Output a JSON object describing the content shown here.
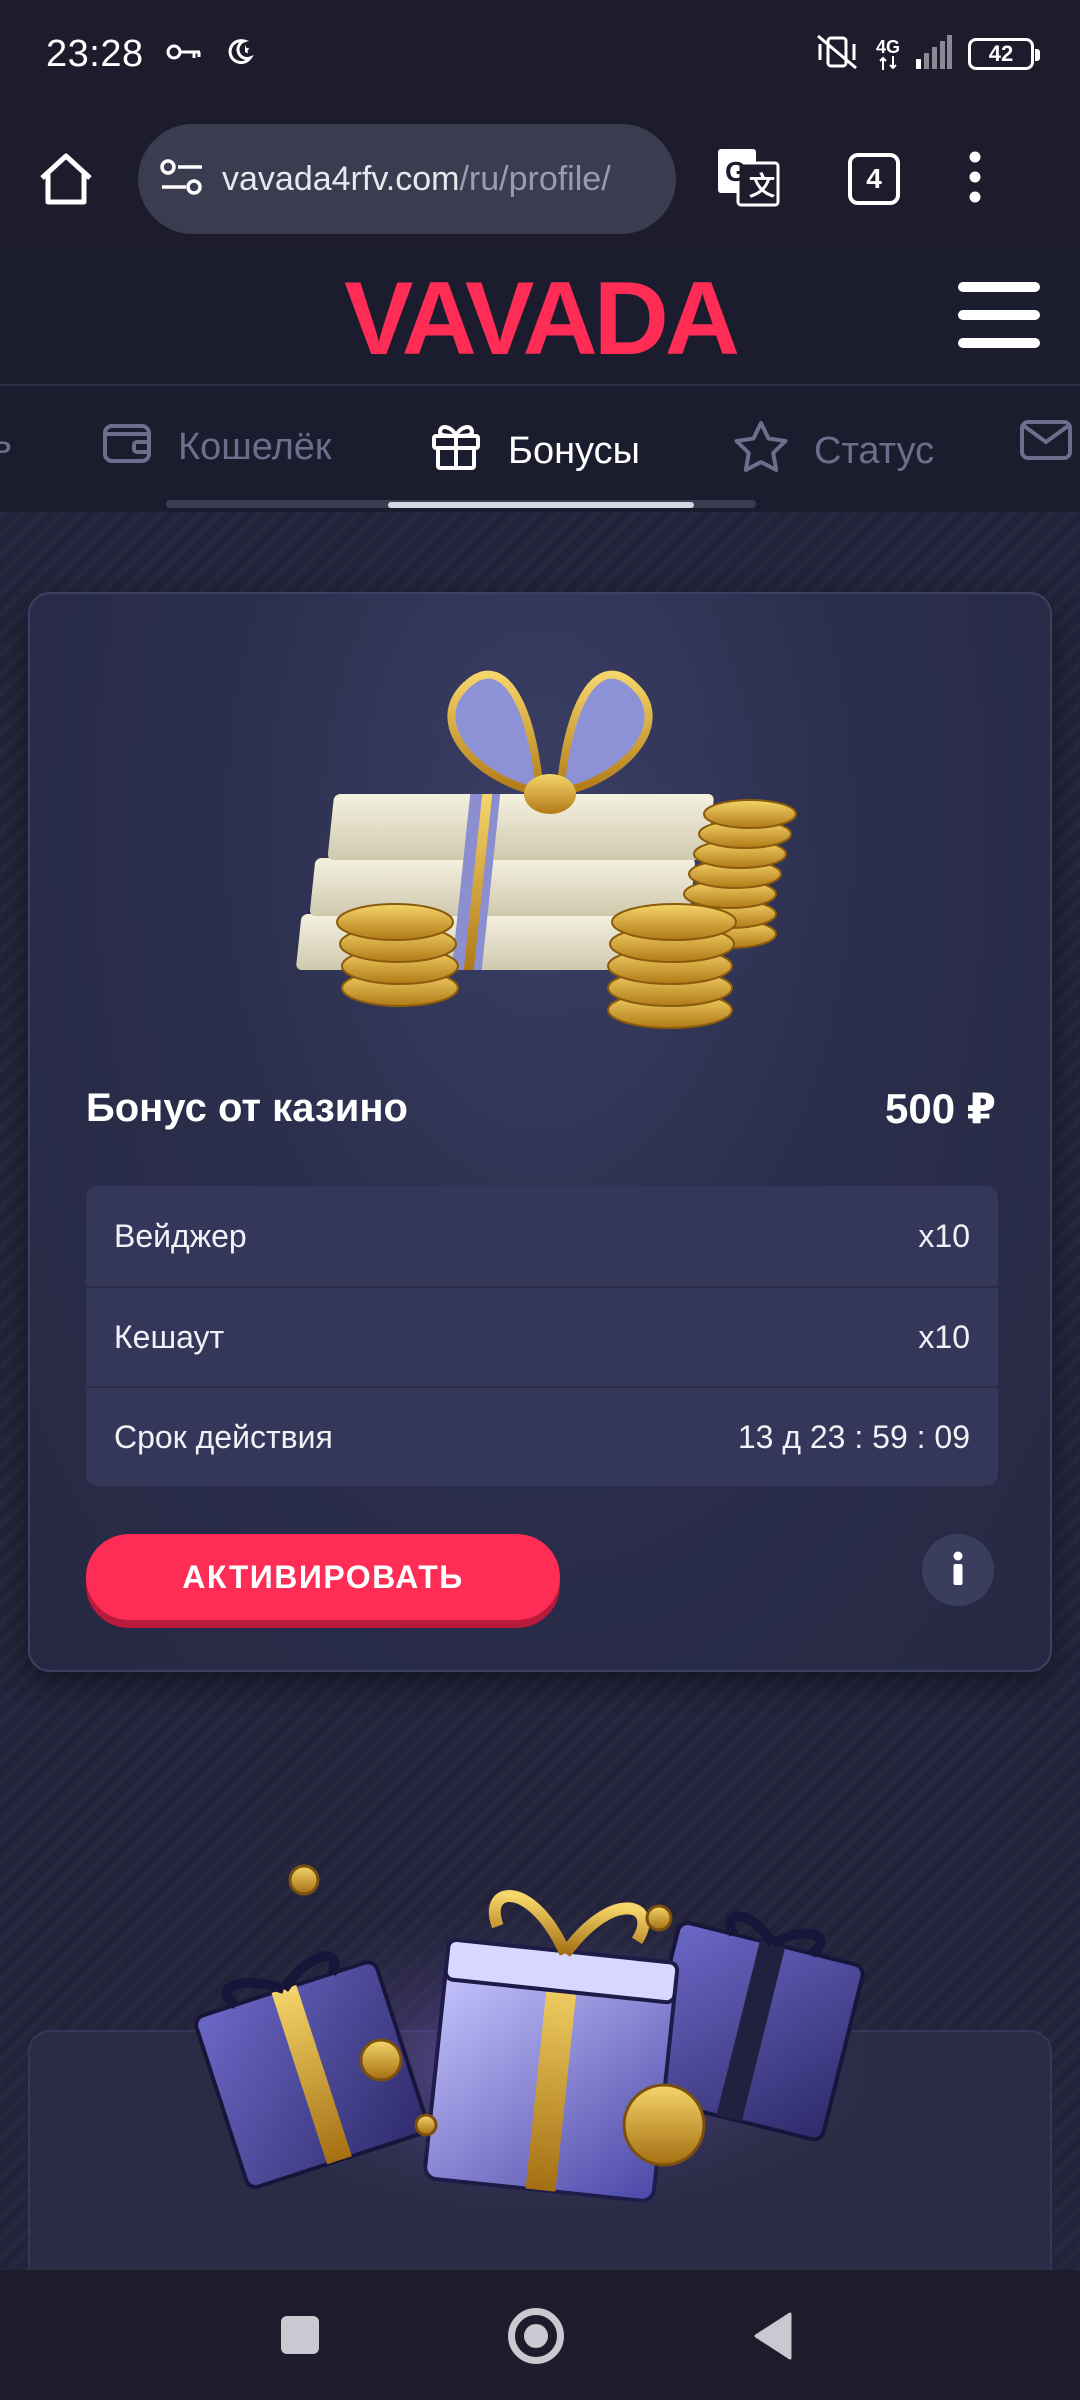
{
  "status_bar": {
    "time": "23:28",
    "network": "4G",
    "battery": "42",
    "icons": [
      "key-icon",
      "moon-icon",
      "vibrate-icon",
      "signal-icon",
      "battery-icon"
    ]
  },
  "browser": {
    "url_host": "vavada4rfv.com",
    "url_path": "/ru/profile/",
    "tab_count": "4",
    "icons": [
      "home-icon",
      "site-settings-icon",
      "translate-icon",
      "more-vert-icon"
    ]
  },
  "site": {
    "logo_text": "VAVADA",
    "brand_color": "#ff2d55"
  },
  "profile_tabs": [
    {
      "label": "ь",
      "icon": "partial-icon",
      "active": false
    },
    {
      "label": "Кошелёк",
      "icon": "wallet-icon",
      "active": false
    },
    {
      "label": "Бонусы",
      "icon": "gift-icon",
      "active": true
    },
    {
      "label": "Статус",
      "icon": "star-icon",
      "active": false
    },
    {
      "label": "",
      "icon": "mail-icon",
      "active": false
    }
  ],
  "bonus": {
    "title": "Бонус от казино",
    "amount": "500 ₽",
    "rows": [
      {
        "label": "Вейджер",
        "value": "x10"
      },
      {
        "label": "Кешаут",
        "value": "x10"
      },
      {
        "label": "Срок действия",
        "value": "13 д 23 : 59 : 09"
      }
    ],
    "activate_label": "АКТИВИРОВАТЬ",
    "info_label": "i"
  }
}
